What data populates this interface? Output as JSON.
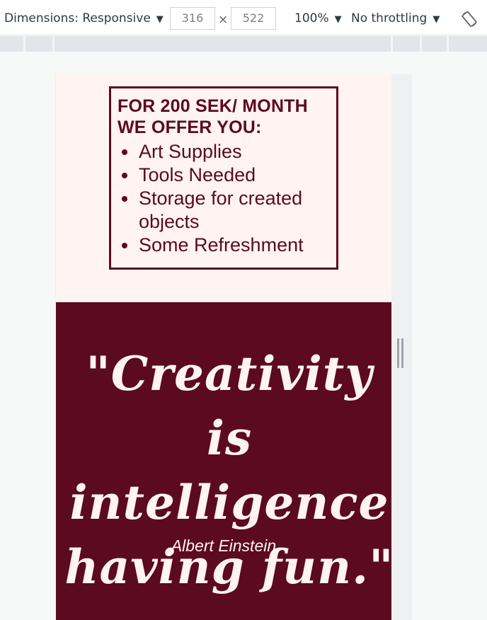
{
  "toolbar": {
    "dimensions_label": "Dimensions: Responsive",
    "width_value": "316",
    "times_symbol": "×",
    "height_value": "522",
    "zoom_label": "100%",
    "throttling_label": "No throttling",
    "dropdown_caret": "▼",
    "rotate_icon": "rotate-icon"
  },
  "offer": {
    "title": "FOR 200 SEK/ MONTH WE OFFER YOU:",
    "items": [
      "Art Supplies",
      "Tools Needed",
      "Storage for created objects",
      "Some Refreshment"
    ]
  },
  "quote": {
    "text": "\"Creativity is intelligence having fun.\"",
    "author": "Albert Einstein"
  },
  "colors": {
    "brand_maroon": "#5c0a1e",
    "cream": "#fff4f2"
  }
}
